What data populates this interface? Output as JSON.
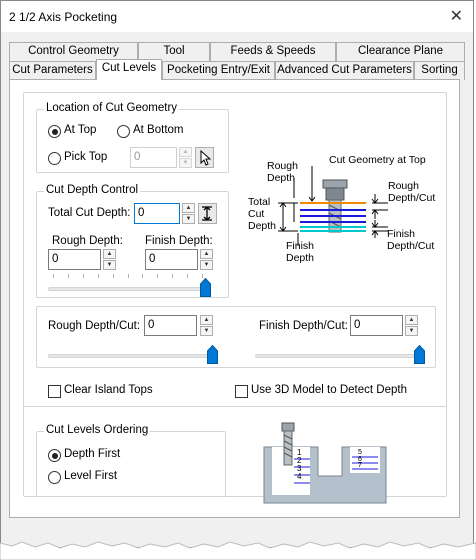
{
  "window": {
    "title": "2 1/2 Axis Pocketing",
    "close_glyph": "✕"
  },
  "tabs_back": [
    "Control Geometry",
    "Tool",
    "Feeds & Speeds",
    "Clearance Plane"
  ],
  "tabs_front": [
    "Cut Parameters",
    "Cut Levels",
    "Pocketing Entry/Exit",
    "Advanced Cut Parameters",
    "Sorting"
  ],
  "active_tab": "Cut Levels",
  "location": {
    "legend": "Location of Cut Geometry",
    "at_top": "At Top",
    "at_bottom": "At Bottom",
    "pick_top": "Pick Top",
    "selected": "At Top",
    "pick_top_value": "0",
    "pick_icon": "cursor-arrow-icon"
  },
  "depth_control": {
    "legend": "Cut Depth Control",
    "total_label": "Total Cut Depth:",
    "total_value": "0",
    "total_icon": "depth-extent-icon",
    "rough_label": "Rough Depth:",
    "rough_value": "0",
    "finish_label": "Finish Depth:",
    "finish_value": "0",
    "slider_level": 1.0
  },
  "diagram": {
    "rough_depth": "Rough\nDepth",
    "cut_geom_top": "Cut Geometry at Top",
    "total_cut_depth": "Total\nCut\nDepth",
    "finish_depth": "Finish\nDepth",
    "rough_depth_cut": "Rough\nDepth/Cut",
    "finish_depth_cut": "Finish\nDepth/Cut",
    "colors": {
      "top_line": "#f08a00",
      "rough_lines": "#1a1adb",
      "finish_lines": "#00c8c8"
    }
  },
  "per_cut": {
    "rough_label": "Rough Depth/Cut:",
    "rough_value": "0",
    "rough_slider_level": 1.0,
    "finish_label": "Finish Depth/Cut:",
    "finish_value": "0",
    "finish_slider_level": 1.0
  },
  "options": {
    "clear_island_tops": "Clear Island Tops",
    "clear_island_tops_checked": false,
    "use_3d_model": "Use 3D Model to Detect Depth",
    "use_3d_model_checked": false
  },
  "ordering": {
    "legend": "Cut Levels Ordering",
    "depth_first": "Depth First",
    "level_first": "Level First",
    "selected": "Depth First"
  },
  "ordering_diagram": {
    "left_levels": [
      "1",
      "2",
      "3",
      "4"
    ],
    "right_levels": [
      "5",
      "6",
      "7"
    ]
  }
}
